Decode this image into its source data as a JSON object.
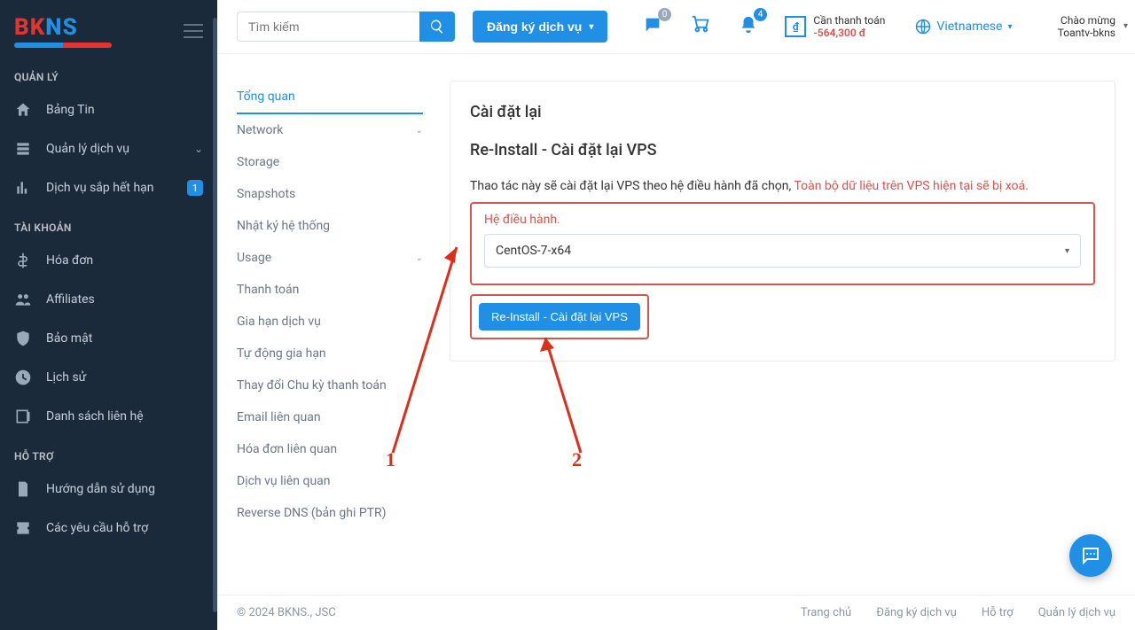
{
  "brand": {
    "name": "BKNS"
  },
  "sidebar": {
    "sections": {
      "manage": {
        "title": "QUẢN LÝ"
      },
      "account": {
        "title": "TÀI KHOẢN"
      },
      "support": {
        "title": "HỖ TRỢ"
      }
    },
    "dashboard": "Bảng Tin",
    "services": "Quản lý dịch vụ",
    "expiring": "Dịch vụ sắp hết hạn",
    "expiring_badge": "1",
    "invoices": "Hóa đơn",
    "affiliates": "Affiliates",
    "security": "Bảo mật",
    "history": "Lịch sử",
    "contacts": "Danh sách liên hệ",
    "howto": "Hướng dẫn sử dụng",
    "tickets": "Các yêu cầu hỗ trợ"
  },
  "topbar": {
    "search_placeholder": "Tìm kiếm",
    "register": "Đăng ký dịch vụ",
    "chat_count": "0",
    "bell_count": "4",
    "pay_title": "Cần thanh toán",
    "pay_amount": "-564,300 đ",
    "language": "Vietnamese",
    "welcome": "Chào mừng",
    "username": "Toantv-bkns"
  },
  "sidemenu": {
    "overview": "Tổng quan",
    "network": "Network",
    "storage": "Storage",
    "snapshots": "Snapshots",
    "syslog": "Nhật ký hệ thống",
    "usage": "Usage",
    "payment": "Thanh toán",
    "renew": "Gia hạn dịch vụ",
    "autorenew": "Tự động gia hạn",
    "change_cycle": "Thay đổi Chu kỳ thanh toán",
    "emails": "Email liên quan",
    "rel_invoices": "Hóa đơn liên quan",
    "rel_services": "Dịch vụ liên quan",
    "rdns": "Reverse DNS (bản ghi PTR)"
  },
  "card": {
    "title": "Cài đặt lại",
    "subtitle": "Re-Install - Cài đặt lại VPS",
    "note": "Thao tác này sẽ cài đặt lại VPS theo hệ điều hành đã chọn,",
    "warn": "Toàn bộ dữ liệu trên VPS hiện tại sẽ bị xoá.",
    "os_label": "Hệ điều hành.",
    "os_value": "CentOS-7-x64",
    "btn": "Re-Install - Cài đặt lại VPS"
  },
  "annot": {
    "one": "1",
    "two": "2"
  },
  "footer": {
    "copyright": "© 2024 BKNS., JSC",
    "home": "Trang chủ",
    "register": "Đăng ký dịch vụ",
    "support": "Hỗ trợ",
    "services": "Quản lý dịch vụ"
  }
}
